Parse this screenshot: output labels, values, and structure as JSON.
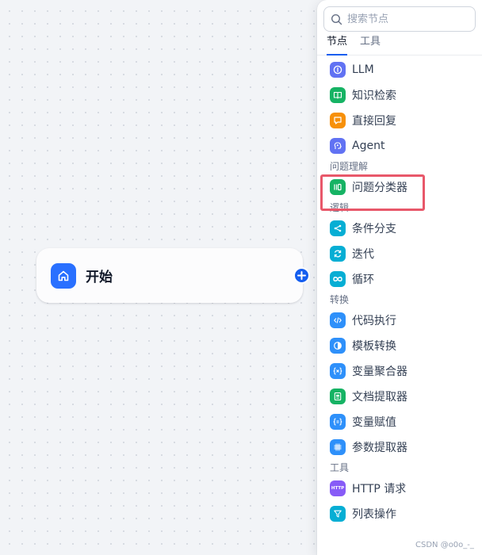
{
  "canvas": {
    "start_node": {
      "title": "开始",
      "icon": "home-icon",
      "color": "#2970ff"
    },
    "add_handle_icon": "plus-icon"
  },
  "panel": {
    "search": {
      "placeholder": "搜索节点",
      "value": ""
    },
    "tabs": [
      {
        "label": "节点",
        "active": true
      },
      {
        "label": "工具",
        "active": false
      }
    ],
    "default_nodes": [
      {
        "label": "LLM",
        "icon": "llm-icon",
        "color": "#6172f3"
      },
      {
        "label": "知识检索",
        "icon": "book-icon",
        "color": "#16b364"
      },
      {
        "label": "直接回复",
        "icon": "reply-icon",
        "color": "#f79009"
      },
      {
        "label": "Agent",
        "icon": "agent-icon",
        "color": "#6172f3"
      }
    ],
    "sections": {
      "understanding": "问题理解",
      "logic": "逻辑",
      "transform": "转换",
      "tools": "工具"
    },
    "understanding_nodes": [
      {
        "label": "问题分类器",
        "icon": "classifier-icon",
        "color": "#16b364"
      }
    ],
    "logic_nodes": [
      {
        "label": "条件分支",
        "icon": "branch-icon",
        "color": "#06aed4"
      },
      {
        "label": "迭代",
        "icon": "loop-icon",
        "color": "#06aed4"
      },
      {
        "label": "循环",
        "icon": "infinity-icon",
        "color": "#06aed4"
      }
    ],
    "transform_nodes": [
      {
        "label": "代码执行",
        "icon": "code-icon",
        "color": "#2e90fa"
      },
      {
        "label": "模板转换",
        "icon": "template-icon",
        "color": "#2e90fa"
      },
      {
        "label": "变量聚合器",
        "icon": "variable-icon",
        "color": "#2e90fa"
      },
      {
        "label": "文档提取器",
        "icon": "doc-extract-icon",
        "color": "#16b364"
      },
      {
        "label": "变量赋值",
        "icon": "assign-icon",
        "color": "#2e90fa"
      },
      {
        "label": "参数提取器",
        "icon": "grid-icon",
        "color": "#2e90fa"
      }
    ],
    "tool_nodes": [
      {
        "label": "HTTP 请求",
        "icon": "http-icon",
        "icon_text": "HTTP",
        "color": "#875bf7"
      },
      {
        "label": "列表操作",
        "icon": "filter-icon",
        "color": "#06aed4"
      }
    ],
    "highlight_color": "#e8586a"
  },
  "watermark": "CSDN @o0o_-_"
}
